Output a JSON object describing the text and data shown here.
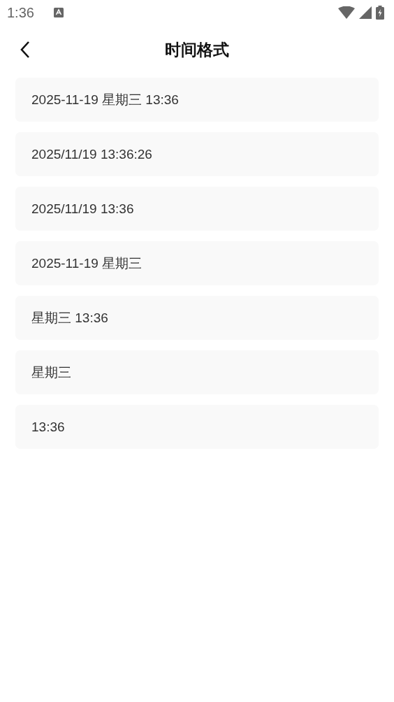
{
  "status_bar": {
    "time": "1:36"
  },
  "header": {
    "title": "时间格式"
  },
  "formats": [
    {
      "label": "2025-11-19 星期三 13:36"
    },
    {
      "label": "2025/11/19 13:36:26"
    },
    {
      "label": "2025/11/19 13:36"
    },
    {
      "label": "2025-11-19 星期三"
    },
    {
      "label": "星期三 13:36"
    },
    {
      "label": "星期三"
    },
    {
      "label": "13:36"
    }
  ]
}
